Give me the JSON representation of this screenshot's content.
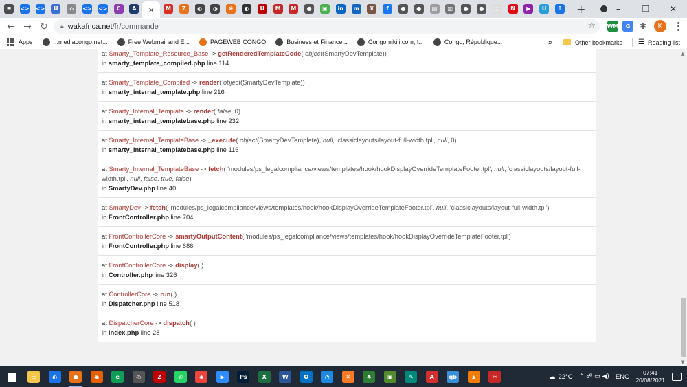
{
  "browser": {
    "tabs": [
      {
        "icon": "generic-site-icon",
        "color": "#4d4d4d",
        "glyph": "≡"
      },
      {
        "icon": "code-icon",
        "color": "#1a73e8",
        "glyph": "<>"
      },
      {
        "icon": "code-icon",
        "color": "#1a73e8",
        "glyph": "<>"
      },
      {
        "icon": "shield-icon",
        "color": "#3b6fd6",
        "glyph": "U"
      },
      {
        "icon": "house-icon",
        "color": "#888888",
        "glyph": "⌂"
      },
      {
        "icon": "code-icon",
        "color": "#1a73e8",
        "glyph": "<>"
      },
      {
        "icon": "code-icon",
        "color": "#1a73e8",
        "glyph": "<>"
      },
      {
        "icon": "app-icon",
        "color": "#8e3db0",
        "glyph": "C"
      },
      {
        "icon": "app-icon",
        "color": "#1e3c72",
        "glyph": "A"
      },
      {
        "icon": "close-icon",
        "color": "#ffffff",
        "glyph": "×",
        "active": true
      },
      {
        "icon": "gmail-icon",
        "color": "#d93025",
        "glyph": "M"
      },
      {
        "icon": "app-icon",
        "color": "#e8711a",
        "glyph": "Z"
      },
      {
        "icon": "app-icon",
        "color": "#444444",
        "glyph": "◐"
      },
      {
        "icon": "app-icon",
        "color": "#444444",
        "glyph": "◑"
      },
      {
        "icon": "app-icon",
        "color": "#e8711a",
        "glyph": "❋"
      },
      {
        "icon": "app-icon",
        "color": "#333333",
        "glyph": "◐"
      },
      {
        "icon": "app-icon",
        "color": "#c00000",
        "glyph": "U"
      },
      {
        "icon": "gmail-icon",
        "color": "#c62828",
        "glyph": "M"
      },
      {
        "icon": "gmail-icon",
        "color": "#c62828",
        "glyph": "M"
      },
      {
        "icon": "globe-icon",
        "color": "#555555",
        "glyph": "●"
      },
      {
        "icon": "app-icon",
        "color": "#4caf50",
        "glyph": "▣"
      },
      {
        "icon": "linkedin-icon",
        "color": "#0a66c2",
        "glyph": "in"
      },
      {
        "icon": "app-icon",
        "color": "#1565c0",
        "glyph": "m"
      },
      {
        "icon": "app-icon",
        "color": "#795548",
        "glyph": "♜"
      },
      {
        "icon": "facebook-icon",
        "color": "#1877f2",
        "glyph": "f"
      },
      {
        "icon": "globe-icon",
        "color": "#555555",
        "glyph": "●"
      },
      {
        "icon": "globe-icon",
        "color": "#555555",
        "glyph": "●"
      },
      {
        "icon": "doc-icon",
        "color": "#9e9e9e",
        "glyph": "▤"
      },
      {
        "icon": "doc-icon",
        "color": "#757575",
        "glyph": "▥"
      },
      {
        "icon": "globe-icon",
        "color": "#555555",
        "glyph": "●"
      },
      {
        "icon": "globe-icon",
        "color": "#555555",
        "glyph": "●"
      },
      {
        "icon": "doc-icon",
        "color": "#dddddd",
        "glyph": "□"
      },
      {
        "icon": "netflix-icon",
        "color": "#e50914",
        "glyph": "N"
      },
      {
        "icon": "play-icon",
        "color": "#8e24aa",
        "glyph": "▶"
      },
      {
        "icon": "app-icon",
        "color": "#2a9fd6",
        "glyph": "U"
      },
      {
        "icon": "download-icon",
        "color": "#1a73e8",
        "glyph": "⇩"
      }
    ],
    "new_tab_glyph": "+",
    "window_controls": [
      "–",
      "❐",
      "✕"
    ],
    "back_glyph": "←",
    "forward_glyph": "→",
    "reload_glyph": "↻",
    "url_host": "wakafrica.net",
    "url_path": "/fr/commande",
    "profile_initial": "K",
    "extensions": [
      {
        "icon": "wm-extension-icon",
        "glyph": "WM",
        "color": "#1e8e3e",
        "text": "#ffffff"
      },
      {
        "icon": "translate-extension-icon",
        "glyph": "G",
        "color": "#4285f4",
        "text": "#ffffff"
      },
      {
        "icon": "puzzle-icon",
        "glyph": "✱",
        "color": "#ffffff",
        "text": "#5f6368"
      }
    ]
  },
  "bookmarks": {
    "apps_label": "Apps",
    "items": [
      {
        "label": ":::mediacongo.net:::",
        "color": "#444444"
      },
      {
        "label": "Free Webmail and E...",
        "color": "#444444"
      },
      {
        "label": "PAGEWEB CONGO",
        "color": "#e8711a"
      },
      {
        "label": "Business et Finance...",
        "color": "#444444"
      },
      {
        "label": "Congomikili.com, t...",
        "color": "#444444"
      },
      {
        "label": "Congo, République...",
        "color": "#444444"
      }
    ],
    "overflow": "»",
    "other_bookmarks": "Other bookmarks",
    "reading_list": "Reading list"
  },
  "trace": [
    {
      "cls": "Smarty_Template_Resource_Base",
      "op": "->",
      "fn": "getRenderedTemplateCode",
      "args_html": "( <em>object</em>(SmartyDevTemplate))",
      "file": "smarty_template_compiled.php",
      "line_label": "line 114"
    },
    {
      "cls": "Smarty_Template_Compiled",
      "op": "->",
      "fn": "render",
      "args_html": "( <em>object</em>(SmartyDevTemplate))",
      "file": "smarty_internal_template.php",
      "line_label": "line 216"
    },
    {
      "cls": "Smarty_Internal_Template",
      "op": "->",
      "fn": "render",
      "args_html": "( <em>false</em>, 0)",
      "file": "smarty_internal_templatebase.php",
      "line_label": "line 232"
    },
    {
      "cls": "Smarty_Internal_TemplateBase",
      "op": "->",
      "fn": "_execute",
      "args_html": "( <em>object</em>(SmartyDevTemplate), <em>null</em>, 'classiclayouts/layout-full-width.tpl', <em>null</em>, 0)",
      "file": "smarty_internal_templatebase.php",
      "line_label": "line 116"
    },
    {
      "cls": "Smarty_Internal_TemplateBase",
      "op": "->",
      "fn": "fetch",
      "args_html": "( 'modules/ps_legalcompliance/views/templates/hook/hookDisplayOverrideTemplateFooter.tpl', <em>null</em>, 'classiclayouts/layout-full-width.tpl', <em>null</em>, <em>false</em>, <em>true</em>, <em>false</em>)",
      "file": "SmartyDev.php",
      "line_label": "line 40"
    },
    {
      "cls": "SmartyDev",
      "op": "->",
      "fn": "fetch",
      "args_html": "( 'modules/ps_legalcompliance/views/templates/hook/hookDisplayOverrideTemplateFooter.tpl', <em>null</em>, 'classiclayouts/layout-full-width.tpl')",
      "file": "FrontController.php",
      "line_label": "line 704"
    },
    {
      "cls": "FrontControllerCore",
      "op": "->",
      "fn": "smartyOutputContent",
      "args_html": "( 'modules/ps_legalcompliance/views/templates/hook/hookDisplayOverrideTemplateFooter.tpl')",
      "file": "FrontController.php",
      "line_label": "line 686"
    },
    {
      "cls": "FrontControllerCore",
      "op": "->",
      "fn": "display",
      "args_html": "( )",
      "file": "Controller.php",
      "line_label": "line 326"
    },
    {
      "cls": "ControllerCore",
      "op": "->",
      "fn": "run",
      "args_html": "( )",
      "file": "Dispatcher.php",
      "line_label": "line 518"
    },
    {
      "cls": "DispatcherCore",
      "op": "->",
      "fn": "dispatch",
      "args_html": "( )",
      "file": "index.php",
      "line_label": "line 28"
    }
  ],
  "labels": {
    "at": "at",
    "in": "in"
  },
  "taskbar": {
    "apps": [
      {
        "icon": "file-explorer-icon",
        "color": "#f4c64c",
        "glyph": "▭"
      },
      {
        "icon": "windows-security-icon",
        "color": "#1a73e8",
        "glyph": "◐"
      },
      {
        "icon": "chrome-icon",
        "color": "#e8711a",
        "glyph": "●",
        "running": true
      },
      {
        "icon": "firefox-icon",
        "color": "#e66000",
        "glyph": "◉"
      },
      {
        "icon": "edge-icon",
        "color": "#0f9d58",
        "glyph": "e"
      },
      {
        "icon": "app-icon",
        "color": "#555555",
        "glyph": "◎"
      },
      {
        "icon": "filezilla-icon",
        "color": "#bf0000",
        "glyph": "Z"
      },
      {
        "icon": "whatsapp-icon",
        "color": "#25d366",
        "glyph": "✆"
      },
      {
        "icon": "anydesk-icon",
        "color": "#ef443b",
        "glyph": "◆"
      },
      {
        "icon": "zoom-icon",
        "color": "#2d8cff",
        "glyph": "▶"
      },
      {
        "icon": "photoshop-icon",
        "color": "#001e36",
        "glyph": "Ps"
      },
      {
        "icon": "excel-icon",
        "color": "#1d6f42",
        "glyph": "X"
      },
      {
        "icon": "word-icon",
        "color": "#2b579a",
        "glyph": "W"
      },
      {
        "icon": "outlook-icon",
        "color": "#0072c6",
        "glyph": "O"
      },
      {
        "icon": "app-icon",
        "color": "#1e88e5",
        "glyph": "◔"
      },
      {
        "icon": "xampp-icon",
        "color": "#fb7a24",
        "glyph": "✕"
      },
      {
        "icon": "app-icon",
        "color": "#2e7d32",
        "glyph": "♣"
      },
      {
        "icon": "app-icon",
        "color": "#558b2f",
        "glyph": "▣"
      },
      {
        "icon": "app-icon",
        "color": "#00897b",
        "glyph": "✎"
      },
      {
        "icon": "acrobat-icon",
        "color": "#d32f2f",
        "glyph": "A"
      },
      {
        "icon": "qbittorrent-icon",
        "color": "#3a8fd9",
        "glyph": "qb"
      },
      {
        "icon": "vlc-icon",
        "color": "#f57c00",
        "glyph": "▲"
      },
      {
        "icon": "app-icon",
        "color": "#c62828",
        "glyph": "✂"
      }
    ],
    "weather": "22°C",
    "tray_glyphs": "⌃  ☍  ▭  ◀)",
    "language": "ENG",
    "time": "07:41",
    "date": "20/08/2021"
  }
}
